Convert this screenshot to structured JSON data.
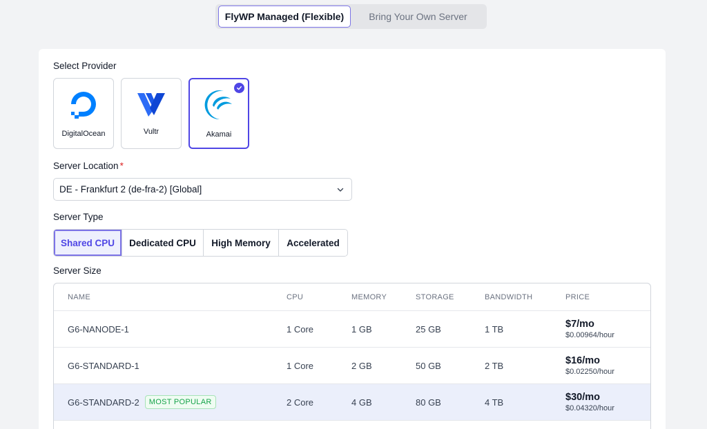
{
  "mode_toggle": {
    "managed_label": "FlyWP Managed (Flexible)",
    "byos_label": "Bring Your Own Server"
  },
  "provider_section": {
    "label": "Select Provider",
    "providers": [
      {
        "name": "DigitalOcean",
        "icon": "digitalocean-logo-icon",
        "selected": false
      },
      {
        "name": "Vultr",
        "icon": "vultr-logo-icon",
        "selected": false
      },
      {
        "name": "Akamai",
        "icon": "akamai-logo-icon",
        "selected": true
      }
    ]
  },
  "location_section": {
    "label": "Server Location",
    "required_mark": "*",
    "selected_value": "DE - Frankfurt 2 (de-fra-2) [Global]"
  },
  "type_section": {
    "label": "Server Type",
    "tabs": [
      "Shared CPU",
      "Dedicated CPU",
      "High Memory",
      "Accelerated"
    ],
    "active_tab": "Shared CPU"
  },
  "size_section": {
    "label": "Server Size",
    "columns": [
      "NAME",
      "CPU",
      "MEMORY",
      "STORAGE",
      "BANDWIDTH",
      "PRICE"
    ],
    "rows": [
      {
        "name": "G6-NANODE-1",
        "cpu": "1 Core",
        "memory": "1 GB",
        "storage": "25 GB",
        "bandwidth": "1 TB",
        "price": "$7/mo",
        "hourly": "$0.00964/hour",
        "badge": ""
      },
      {
        "name": "G6-STANDARD-1",
        "cpu": "1 Core",
        "memory": "2 GB",
        "storage": "50 GB",
        "bandwidth": "2 TB",
        "price": "$16/mo",
        "hourly": "$0.02250/hour",
        "badge": ""
      },
      {
        "name": "G6-STANDARD-2",
        "cpu": "2 Core",
        "memory": "4 GB",
        "storage": "80 GB",
        "bandwidth": "4 TB",
        "price": "$30/mo",
        "hourly": "$0.04320/hour",
        "badge": "MOST POPULAR"
      }
    ]
  },
  "colors": {
    "accent": "#4f46e5",
    "digitalocean_blue": "#0080ff",
    "vultr_blue": "#1e64ff",
    "akamai_blue": "#009bde",
    "popular_green": "#16a34a"
  }
}
